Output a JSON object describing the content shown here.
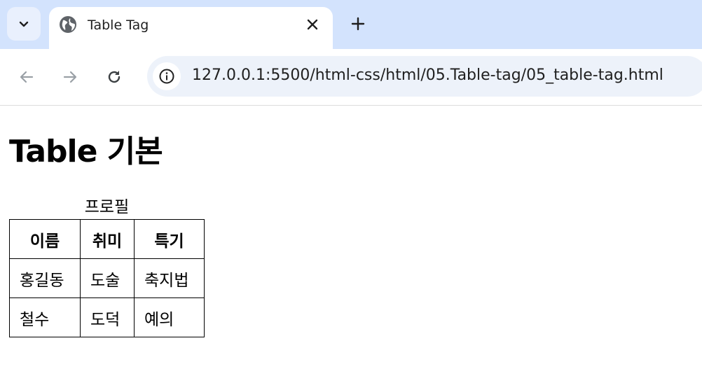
{
  "browser": {
    "tab_title": "Table Tag",
    "url": "127.0.0.1:5500/html-css/html/05.Table-tag/05_table-tag.html",
    "icons": {
      "tab_dropdown": "chevron-down-icon",
      "tab_favicon": "globe-icon",
      "tab_close": "close-icon",
      "new_tab": "plus-icon",
      "back": "arrow-left-icon",
      "forward": "arrow-right-icon",
      "reload": "reload-icon",
      "site_info": "info-icon"
    },
    "colors": {
      "tabstrip": "#d3e3fd",
      "omnibox": "#edf2fa"
    }
  },
  "page": {
    "heading": "Table 기본",
    "table": {
      "caption": "프로필",
      "headers": [
        "이름",
        "취미",
        "특기"
      ],
      "rows": [
        [
          "홍길동",
          "도술",
          "축지법"
        ],
        [
          "철수",
          "도덕",
          "예의"
        ]
      ]
    }
  }
}
